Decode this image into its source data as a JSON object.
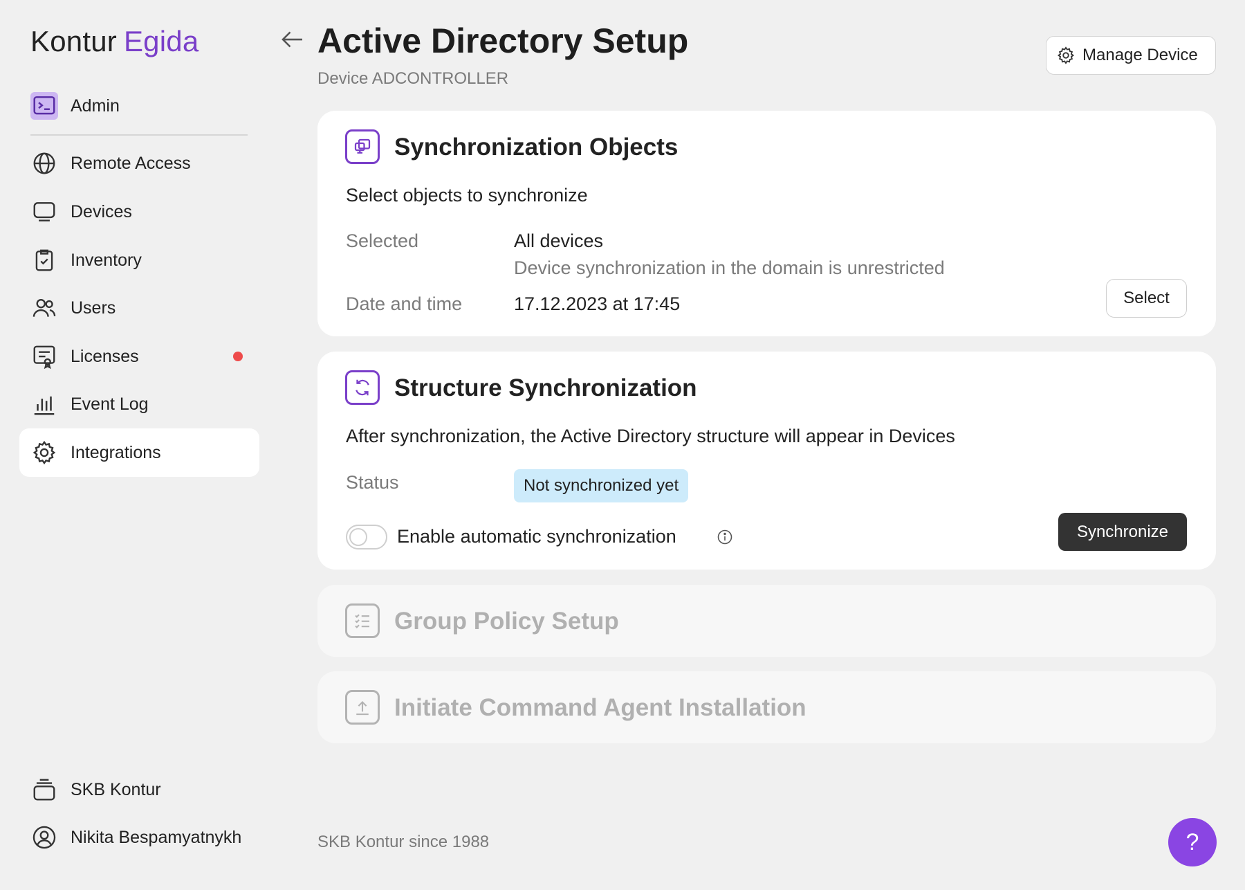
{
  "brand": {
    "name": "Kontur",
    "accent": "Egida",
    "accent_color": "#7a3fc9"
  },
  "sidebar": {
    "admin_label": "Admin",
    "items": [
      {
        "label": "Remote Access",
        "icon": "globe-icon"
      },
      {
        "label": "Devices",
        "icon": "monitor-icon"
      },
      {
        "label": "Inventory",
        "icon": "clipboard-check-icon"
      },
      {
        "label": "Users",
        "icon": "users-icon"
      },
      {
        "label": "Licenses",
        "icon": "certificate-icon",
        "has_alert": true
      },
      {
        "label": "Event Log",
        "icon": "bar-chart-icon"
      },
      {
        "label": "Integrations",
        "icon": "gear-icon",
        "active": true
      }
    ],
    "org_label": "SKB Kontur",
    "user_label": "Nikita Bespamyatnykh"
  },
  "header": {
    "title": "Active Directory Setup",
    "subtitle": "Device ADCONTROLLER",
    "manage_label": "Manage Device"
  },
  "sync_objects": {
    "title": "Synchronization Objects",
    "description": "Select objects to synchronize",
    "selected_key": "Selected",
    "selected_value": "All devices",
    "selected_note": "Device synchronization in the domain is unrestricted",
    "datetime_key": "Date and time",
    "datetime_value": "17.12.2023 at 17:45",
    "select_label": "Select"
  },
  "structure_sync": {
    "title": "Structure Synchronization",
    "description": "After synchronization, the Active Directory structure will appear in Devices",
    "status_key": "Status",
    "status_value": "Not synchronized yet",
    "toggle_label": "Enable automatic synchronization",
    "toggle_on": false,
    "sync_label": "Synchronize"
  },
  "group_policy": {
    "title": "Group Policy Setup"
  },
  "agent_install": {
    "title": "Initiate Command Agent Installation"
  },
  "footer": {
    "text": "SKB Kontur since 1988",
    "help_label": "?"
  }
}
